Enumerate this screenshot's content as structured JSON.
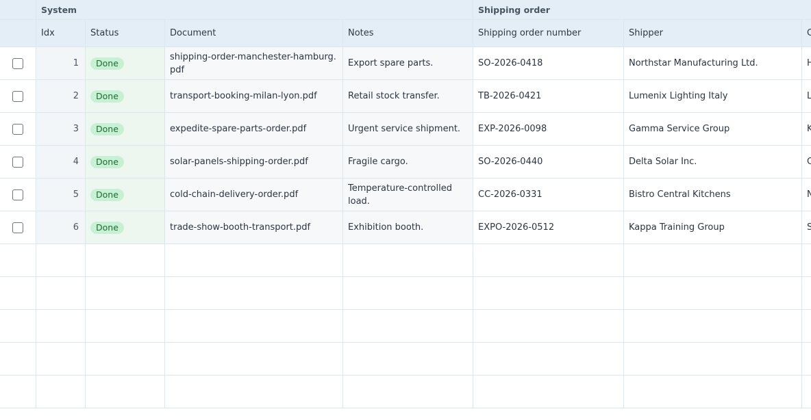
{
  "groups": {
    "system": "System",
    "shipping_order": "Shipping order"
  },
  "columns": {
    "idx": "Idx",
    "status": "Status",
    "document": "Document",
    "notes": "Notes",
    "shipping_order_number": "Shipping order number",
    "shipper": "Shipper",
    "next": "C"
  },
  "rows": [
    {
      "idx": "1",
      "status": "Done",
      "document": "shipping-order-manchester-hamburg.pdf",
      "notes": "Export spare parts.",
      "order": "SO-2026-0418",
      "shipper": "Northstar Manufacturing Ltd.",
      "next": "H"
    },
    {
      "idx": "2",
      "status": "Done",
      "document": "transport-booking-milan-lyon.pdf",
      "notes": "Retail stock transfer.",
      "order": "TB-2026-0421",
      "shipper": "Lumenix Lighting Italy",
      "next": "L"
    },
    {
      "idx": "3",
      "status": "Done",
      "document": "expedite-spare-parts-order.pdf",
      "notes": "Urgent service shipment.",
      "order": "EXP-2026-0098",
      "shipper": "Gamma Service Group",
      "next": "K"
    },
    {
      "idx": "4",
      "status": "Done",
      "document": "solar-panels-shipping-order.pdf",
      "notes": "Fragile cargo.",
      "order": "SO-2026-0440",
      "shipper": "Delta Solar Inc.",
      "next": "C"
    },
    {
      "idx": "5",
      "status": "Done",
      "document": "cold-chain-delivery-order.pdf",
      "notes": "Temperature-controlled load.",
      "order": "CC-2026-0331",
      "shipper": "Bistro Central Kitchens",
      "next": "N"
    },
    {
      "idx": "6",
      "status": "Done",
      "document": "trade-show-booth-transport.pdf",
      "notes": "Exhibition booth.",
      "order": "EXPO-2026-0512",
      "shipper": "Kappa Training Group",
      "next": "S"
    }
  ],
  "colors": {
    "header_bg": "#e3eef6",
    "badge_bg": "#c8f1d3",
    "badge_text": "#1f6a33",
    "status_col_bg": "#edf7ef"
  }
}
